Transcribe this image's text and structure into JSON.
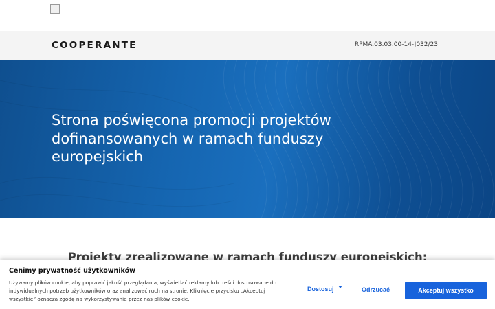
{
  "header": {
    "logo_text": "COOPERANTE",
    "project_code": "RPMA.03.03.00-14-J032/23"
  },
  "hero": {
    "title": "Strona poświęcona promocji projektów dofinansowanych w ramach funduszy europejskich"
  },
  "main": {
    "section_title": "Projekty zrealizowane w ramach funduszy europejskich:"
  },
  "cookie_banner": {
    "title": "Cenimy prywatność użytkowników",
    "text": "Używamy plików cookie, aby poprawić jakość przeglądania, wyświetlać reklamy lub treści dostosowane do indywidualnych potrzeb użytkowników oraz analizować ruch na stronie. Kliknięcie przycisku „Akceptuj wszystkie” oznacza zgodę na wykorzystywanie przez nas plików cookie.",
    "customize_label": "Dostosuj",
    "reject_label": "Odrzucać",
    "accept_label": "Akceptuj wszystko",
    "accent_color": "#1863dc"
  },
  "colors": {
    "hero_blue": "#1565b0",
    "header_bg": "#f4f4f4"
  }
}
